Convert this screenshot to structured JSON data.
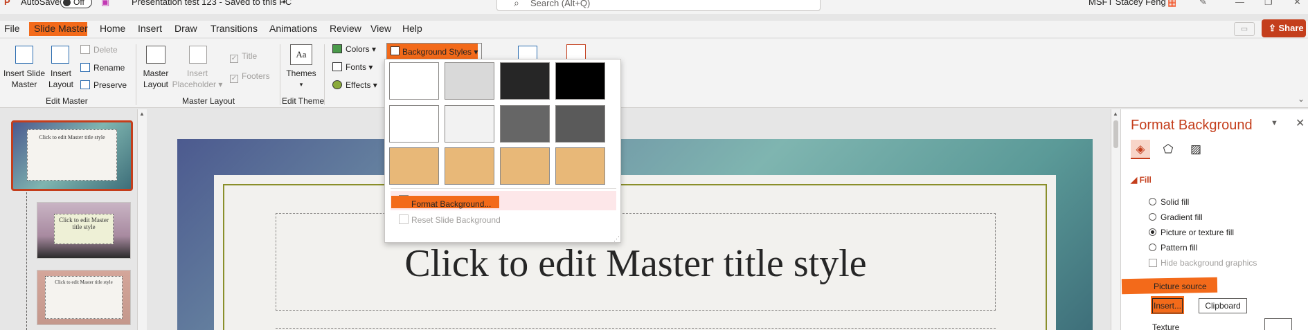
{
  "titlebar": {
    "autosave_label": "AutoSave",
    "autosave_state": "Off",
    "doc_title": "Presentation test 123  -  Saved to this PC",
    "search_placeholder": "Search (Alt+Q)",
    "user_name": "MSFT Stacey Feng"
  },
  "tabs": [
    "File",
    "Slide Master",
    "Home",
    "Insert",
    "Draw",
    "Transitions",
    "Animations",
    "Review",
    "View",
    "Help"
  ],
  "share_label": "Share",
  "ribbon": {
    "edit_master": {
      "insert_slide_master": [
        "Insert Slide",
        "Master"
      ],
      "insert_layout": [
        "Insert",
        "Layout"
      ],
      "delete": "Delete",
      "rename": "Rename",
      "preserve": "Preserve",
      "group_label": "Edit Master"
    },
    "master_layout": {
      "master_layout": [
        "Master",
        "Layout"
      ],
      "insert_placeholder": [
        "Insert",
        "Placeholder"
      ],
      "title": "Title",
      "footers": "Footers",
      "group_label": "Master Layout"
    },
    "edit_theme": {
      "themes": "Themes",
      "group_label": "Edit Theme"
    },
    "background": {
      "colors": "Colors",
      "fonts": "Fonts",
      "effects": "Effects",
      "background_styles": "Background Styles"
    }
  },
  "dropdown": {
    "swatches": [
      "#ffffff",
      "#d9d9d9",
      "#262626",
      "#000000",
      "#ffffff",
      "#f2f2f2",
      "#666666",
      "#5a5a5a",
      "#e8b878",
      "#e8b878",
      "#e8b878",
      "#e8b878"
    ],
    "format_background": "Format Background...",
    "reset_background": "Reset Slide Background"
  },
  "thumbnails": [
    {
      "title": "Click to edit Master title style"
    },
    {
      "title": "Click to edit Master title style"
    },
    {
      "title": "Click to edit Master title style"
    }
  ],
  "slide": {
    "title": "Click to edit Master title style"
  },
  "format_pane": {
    "title": "Format Background",
    "section": "Fill",
    "options": [
      "Solid fill",
      "Gradient fill",
      "Picture or texture fill",
      "Pattern fill"
    ],
    "selected_option": "Picture or texture fill",
    "hide_graphics": "Hide background graphics",
    "picture_source": "Picture source",
    "insert_btn": "Insert...",
    "clipboard_btn": "Clipboard",
    "texture": "Texture"
  },
  "colors": {
    "accent": "#c43e1c",
    "annotation_orange": "#f36a1a"
  }
}
